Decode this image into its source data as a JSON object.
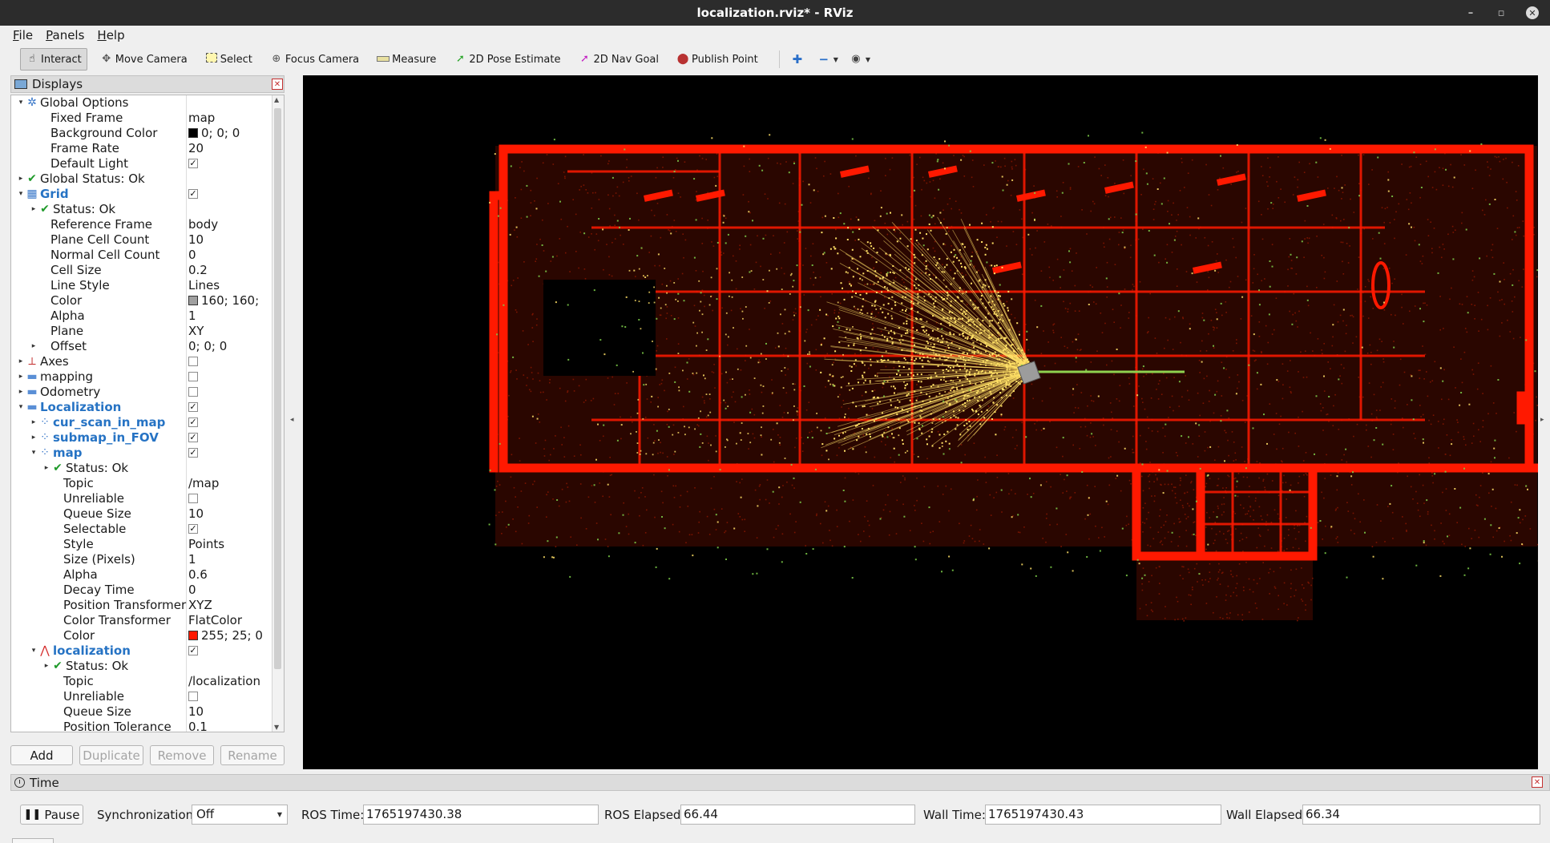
{
  "window": {
    "title": "localization.rviz* - RViz",
    "minimize": "–",
    "maximize": "▫",
    "close": "✕"
  },
  "menu": [
    "File",
    "Panels",
    "Help"
  ],
  "toolbar": {
    "tools": [
      {
        "label": "Interact",
        "icon": "hand-pointer-icon",
        "active": true
      },
      {
        "label": "Move Camera",
        "icon": "move-camera-icon"
      },
      {
        "label": "Select",
        "icon": "select-box-icon"
      },
      {
        "label": "Focus Camera",
        "icon": "focus-camera-icon"
      },
      {
        "label": "Measure",
        "icon": "ruler-icon"
      },
      {
        "label": "2D Pose Estimate",
        "icon": "green-arrow-icon"
      },
      {
        "label": "2D Nav Goal",
        "icon": "magenta-arrow-icon"
      },
      {
        "label": "Publish Point",
        "icon": "map-pin-icon"
      }
    ],
    "extra_icons": [
      "plus-icon",
      "minus-icon",
      "eye-icon"
    ]
  },
  "displays": {
    "title": "Displays",
    "tree": [
      {
        "depth": 0,
        "expand": "open",
        "icon": "gear-icon",
        "name": "Global Options"
      },
      {
        "depth": 1,
        "name": "Fixed Frame",
        "value": "map"
      },
      {
        "depth": 1,
        "name": "Background Color",
        "value": "0; 0; 0",
        "swatch": "#000000"
      },
      {
        "depth": 1,
        "name": "Frame Rate",
        "value": "20"
      },
      {
        "depth": 1,
        "name": "Default Light",
        "check": true
      },
      {
        "depth": 0,
        "expand": "closed",
        "icon": "check-icon",
        "name": "Global Status: Ok"
      },
      {
        "depth": 0,
        "expand": "open",
        "icon": "grid-icon",
        "name": "Grid",
        "bold": true,
        "check": true
      },
      {
        "depth": 1,
        "expand": "closed",
        "icon": "check-icon",
        "name": "Status: Ok"
      },
      {
        "depth": 1,
        "name": "Reference Frame",
        "value": "body"
      },
      {
        "depth": 1,
        "name": "Plane Cell Count",
        "value": "10"
      },
      {
        "depth": 1,
        "name": "Normal Cell Count",
        "value": "0"
      },
      {
        "depth": 1,
        "name": "Cell Size",
        "value": "0.2"
      },
      {
        "depth": 1,
        "name": "Line Style",
        "value": "Lines"
      },
      {
        "depth": 1,
        "name": "Color",
        "value": "160; 160;",
        "swatch": "#a0a0a0"
      },
      {
        "depth": 1,
        "name": "Alpha",
        "value": "1"
      },
      {
        "depth": 1,
        "name": "Plane",
        "value": "XY"
      },
      {
        "depth": 1,
        "expand": "closed",
        "name": "Offset",
        "value": "0; 0; 0"
      },
      {
        "depth": 0,
        "expand": "closed",
        "icon": "axes-icon",
        "name": "Axes",
        "check": false
      },
      {
        "depth": 0,
        "expand": "closed",
        "icon": "folder-icon",
        "name": "mapping",
        "check": false
      },
      {
        "depth": 0,
        "expand": "closed",
        "icon": "folder-icon",
        "name": "Odometry",
        "check": false
      },
      {
        "depth": 0,
        "expand": "open",
        "icon": "folder-icon",
        "name": "Localization",
        "bold": true,
        "check": true
      },
      {
        "depth": 1,
        "expand": "closed",
        "icon": "pointcloud-icon",
        "name": "cur_scan_in_map",
        "bold": true,
        "check": true
      },
      {
        "depth": 1,
        "expand": "closed",
        "icon": "pointcloud-icon",
        "name": "submap_in_FOV",
        "bold": true,
        "check": true
      },
      {
        "depth": 1,
        "expand": "open",
        "icon": "pointcloud-icon",
        "name": "map",
        "bold": true,
        "check": true
      },
      {
        "depth": 2,
        "expand": "closed",
        "icon": "check-icon",
        "name": "Status: Ok"
      },
      {
        "depth": 2,
        "name": "Topic",
        "value": "/map"
      },
      {
        "depth": 2,
        "name": "Unreliable",
        "check": false
      },
      {
        "depth": 2,
        "name": "Queue Size",
        "value": "10"
      },
      {
        "depth": 2,
        "name": "Selectable",
        "check": true
      },
      {
        "depth": 2,
        "name": "Style",
        "value": "Points"
      },
      {
        "depth": 2,
        "name": "Size (Pixels)",
        "value": "1"
      },
      {
        "depth": 2,
        "name": "Alpha",
        "value": "0.6"
      },
      {
        "depth": 2,
        "name": "Decay Time",
        "value": "0"
      },
      {
        "depth": 2,
        "name": "Position Transformer",
        "value": "XYZ"
      },
      {
        "depth": 2,
        "name": "Color Transformer",
        "value": "FlatColor"
      },
      {
        "depth": 2,
        "name": "Color",
        "value": "255; 25; 0",
        "swatch": "#ff1900"
      },
      {
        "depth": 1,
        "expand": "open",
        "icon": "odometry-arrow-icon",
        "name": "localization",
        "bold": true,
        "check": true
      },
      {
        "depth": 2,
        "expand": "closed",
        "icon": "check-icon",
        "name": "Status: Ok"
      },
      {
        "depth": 2,
        "name": "Topic",
        "value": "/localization"
      },
      {
        "depth": 2,
        "name": "Unreliable",
        "check": false
      },
      {
        "depth": 2,
        "name": "Queue Size",
        "value": "10"
      },
      {
        "depth": 2,
        "name": "Position Tolerance",
        "value": "0.1"
      }
    ],
    "buttons": {
      "add": "Add",
      "duplicate": "Duplicate",
      "remove": "Remove",
      "rename": "Rename"
    }
  },
  "colors": {
    "map_points": "#ff1900",
    "scan_points": "#ffe066",
    "sparse_points": "#7fd04a",
    "trajectory": "#8fd14f",
    "accent_blue": "#2673c4"
  },
  "time": {
    "title": "Time",
    "pause_label": "Pause",
    "sync_label": "Synchronization:",
    "sync_value": "Off",
    "ros_time_label": "ROS Time:",
    "ros_time": "1765197430.38",
    "ros_elapsed_label": "ROS Elapsed:",
    "ros_elapsed": "66.44",
    "wall_time_label": "Wall Time:",
    "wall_time": "1765197430.43",
    "wall_elapsed_label": "Wall Elapsed:",
    "wall_elapsed": "66.34"
  }
}
